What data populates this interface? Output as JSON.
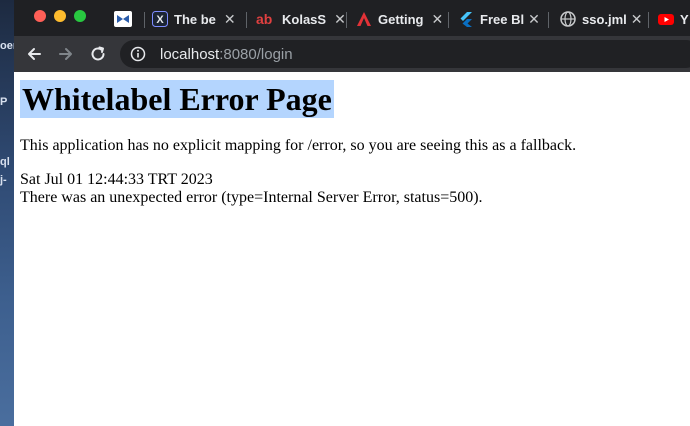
{
  "desktop": {
    "labels": [
      "oer",
      "P",
      "ql",
      "j-"
    ]
  },
  "tabs": [
    {
      "label": "",
      "icon": "bowtie-icon"
    },
    {
      "label": "The be",
      "icon": "x-logo-icon"
    },
    {
      "label": "KolasS",
      "icon": "ab-logo-icon"
    },
    {
      "label": "Getting",
      "icon": "angular-logo-icon"
    },
    {
      "label": "Free Bl",
      "icon": "flutter-logo-icon"
    },
    {
      "label": "sso.jml",
      "icon": "globe-icon"
    },
    {
      "label": "Y",
      "icon": "youtube-icon"
    }
  ],
  "toolbar": {
    "url_host": "localhost",
    "url_path": ":8080/login"
  },
  "page": {
    "heading": "Whitelabel Error Page",
    "message": "This application has no explicit mapping for /error, so you are seeing this as a fallback.",
    "timestamp": "Sat Jul 01 12:44:33 TRT 2023",
    "error": "There was an unexpected error (type=Internal Server Error, status=500)."
  },
  "colors": {
    "close": "#ff5f57",
    "minimize": "#febc2e",
    "maximize": "#28c840",
    "selection": "#b4d5fe"
  }
}
